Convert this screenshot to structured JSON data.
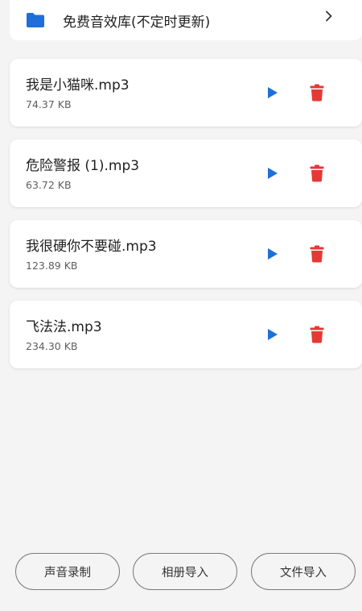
{
  "library": {
    "icon": "folder-icon",
    "title": "免费音效库(不定时更新)",
    "chevron_icon": "chevron-right-icon",
    "accent": "#1e6fd9"
  },
  "files": [
    {
      "name": "我是小猫咪.mp3",
      "size": "74.37 KB"
    },
    {
      "name": "危险警报 (1).mp3",
      "size": "63.72 KB"
    },
    {
      "name": "我很硬你不要碰.mp3",
      "size": "123.89 KB"
    },
    {
      "name": "飞法法.mp3",
      "size": "234.30 KB"
    }
  ],
  "icons": {
    "play": "play-icon",
    "delete": "trash-icon",
    "play_color": "#1e6fd9",
    "delete_color": "#e53935"
  },
  "bottom_buttons": {
    "record": "声音录制",
    "album_import": "相册导入",
    "file_import": "文件导入"
  }
}
